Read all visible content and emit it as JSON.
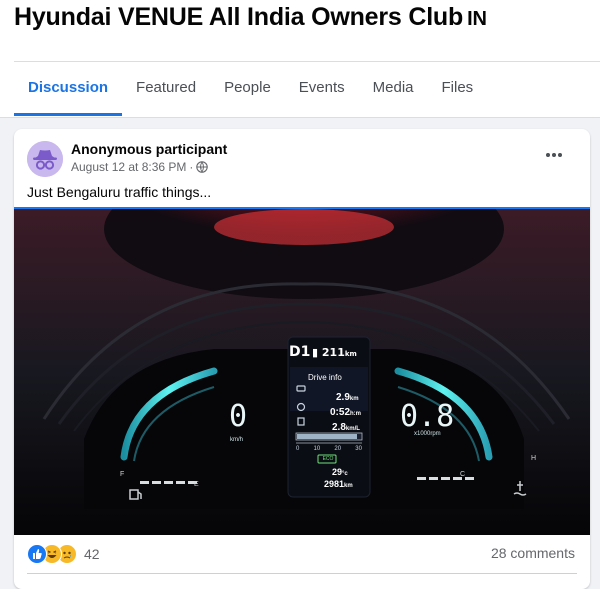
{
  "group": {
    "title": "Hyundai VENUE All India Owners Club",
    "country_code": "IN"
  },
  "tabs": [
    {
      "label": "Discussion",
      "active": true
    },
    {
      "label": "Featured"
    },
    {
      "label": "People"
    },
    {
      "label": "Events"
    },
    {
      "label": "Media"
    },
    {
      "label": "Files"
    }
  ],
  "post": {
    "author": "Anonymous participant",
    "timestamp": "August 12 at 8:36 PM",
    "privacy_icon": "globe-icon",
    "text": "Just Bengaluru traffic things...",
    "more_icon": "more-options-icon",
    "photo": {
      "gear": "D1",
      "range": "211",
      "range_unit": "km",
      "drive_info_label": "Drive info",
      "trip_distance": "2.9",
      "trip_distance_unit": "km",
      "trip_time": "0:52",
      "trip_time_unit": "h:m",
      "fuel_economy": "2.8",
      "fuel_economy_unit": "km/L",
      "gauge_ticks": [
        "0",
        "10",
        "20",
        "30"
      ],
      "eco_badge": "ECO",
      "speed": "0",
      "speed_unit": "km/h",
      "rpm": "0.8",
      "rpm_unit": "x1000rpm",
      "temperature": "29",
      "temperature_unit": "°c",
      "odometer": "2981",
      "odometer_unit": "km",
      "fuel_full_label": "F",
      "fuel_empty_label": "E",
      "temp_cold_label": "C",
      "temp_hot_label": "H"
    },
    "reactions": {
      "icons": [
        "like-reaction-icon",
        "haha-reaction-icon",
        "sad-reaction-icon"
      ],
      "count": "42"
    },
    "comments": "28 comments"
  },
  "colors": {
    "accent": "#1b74e4",
    "gauge": "#3fd6d8",
    "panel_bg": "#0a0a0c"
  }
}
